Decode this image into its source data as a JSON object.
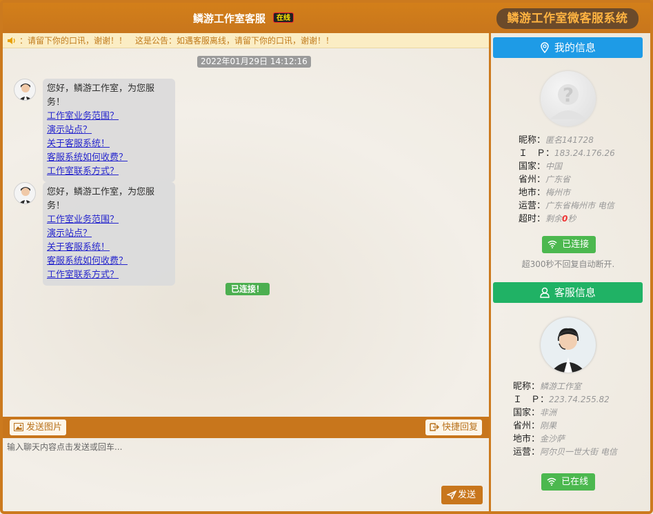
{
  "header": {
    "chat_title": "鳞游工作室客服",
    "online_tag": "在线",
    "brand": "鳞游工作室微客服系统"
  },
  "notice": {
    "text": "：请留下你的口讯，谢谢！！　这是公告：如遇客服离线，请留下你的口讯，谢谢！！"
  },
  "chat": {
    "timestamp": "2022年01月29日 14:12:16",
    "messages": [
      {
        "greeting": "您好，鳞游工作室，为您服务！",
        "links": [
          "工作室业务范围？",
          "演示站点？",
          "关于客服系统！",
          "客服系统如何收费？",
          "工作室联系方式？"
        ]
      },
      {
        "greeting": "您好，鳞游工作室，为您服务！",
        "links": [
          "工作室业务范围？",
          "演示站点？",
          "关于客服系统！",
          "客服系统如何收费？",
          "工作室联系方式？"
        ]
      }
    ],
    "connected_label": "已连接！"
  },
  "toolbar": {
    "send_image_label": "发送图片",
    "quick_reply_label": "快捷回复"
  },
  "input": {
    "placeholder": "输入聊天内容点击发送或回车..."
  },
  "send_label": "发送",
  "my_info": {
    "title": "我的信息",
    "rows": [
      {
        "k": "昵称：",
        "v": "匿名141728"
      },
      {
        "k": "Ｉ　Ｐ：",
        "v": "183.24.176.26"
      },
      {
        "k": "国家：",
        "v": "中国"
      },
      {
        "k": "省州：",
        "v": "广东省"
      },
      {
        "k": "地市：",
        "v": "梅州市"
      },
      {
        "k": "运营：",
        "v": "广东省梅州市 电信"
      }
    ],
    "timeout_key": "超时：",
    "timeout_prefix": "剩余",
    "timeout_num": "0",
    "timeout_suffix": "秒",
    "status_label": "已连接",
    "note": "超300秒不回复自动断开."
  },
  "cs_info": {
    "title": "客服信息",
    "rows": [
      {
        "k": "昵称：",
        "v": "鳞游工作室"
      },
      {
        "k": "Ｉ　Ｐ：",
        "v": "223.74.255.82"
      },
      {
        "k": "国家：",
        "v": "非洲"
      },
      {
        "k": "省州：",
        "v": "刚果"
      },
      {
        "k": "地市：",
        "v": "金沙萨"
      },
      {
        "k": "运营：",
        "v": "阿尔贝一世大街 电信"
      }
    ],
    "status_label": "已在线"
  },
  "colors": {
    "accent": "#c8761c",
    "blue": "#1e9be6",
    "green": "#20b265",
    "status_green": "#4cb84f",
    "link": "#1a1acc"
  },
  "icons": [
    "speaker-icon",
    "image-icon",
    "quick-reply-icon",
    "send-icon",
    "location-icon",
    "user-icon",
    "wifi-icon"
  ]
}
